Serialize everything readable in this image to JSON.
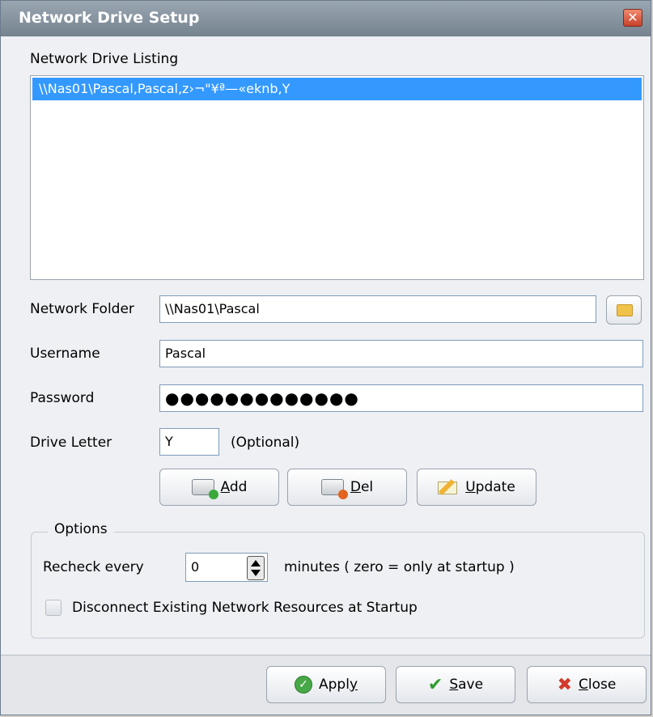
{
  "window": {
    "title": "Network Drive Setup",
    "close_glyph": "✕"
  },
  "listing": {
    "label": "Network Drive Listing",
    "items": [
      "\\\\Nas01\\Pascal,Pascal,z›¬\"¥ª—«eknb,Y"
    ]
  },
  "form": {
    "network_folder": {
      "label": "Network Folder",
      "value": "\\\\Nas01\\Pascal"
    },
    "username": {
      "label": "Username",
      "value": "Pascal"
    },
    "password": {
      "label": "Password",
      "value": "●●●●●●●●●●●●●"
    },
    "drive_letter": {
      "label": "Drive Letter",
      "value": "Y",
      "hint": "(Optional)"
    }
  },
  "actions": {
    "add": {
      "pre": "",
      "key": "A",
      "post": "dd"
    },
    "del": {
      "pre": "",
      "key": "D",
      "post": "el"
    },
    "update": {
      "pre": "",
      "key": "U",
      "post": "pdate"
    }
  },
  "options": {
    "legend": "Options",
    "recheck_label": "Recheck every",
    "recheck_value": "0",
    "recheck_suffix": "minutes ( zero = only at startup )",
    "disconnect_label": "Disconnect Existing Network Resources at Startup",
    "disconnect_checked": false
  },
  "footer": {
    "apply": {
      "pre": "Appl",
      "key": "y",
      "post": ""
    },
    "save": {
      "pre": "",
      "key": "S",
      "post": "ave"
    },
    "close": {
      "pre": "",
      "key": "C",
      "post": "lose"
    }
  },
  "icons": {
    "browse": "folder-icon",
    "add": "add-drive-icon",
    "del": "delete-drive-icon",
    "update": "update-icon",
    "apply": "apply-icon",
    "save": "checkmark-icon",
    "close": "red-x-icon"
  },
  "colors": {
    "title_bar": "#75838f",
    "selection": "#3399ff",
    "close_button": "#c8402a"
  }
}
